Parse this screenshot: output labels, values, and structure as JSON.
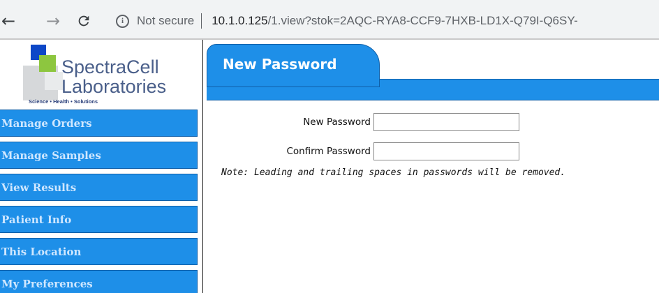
{
  "browser": {
    "nav": {
      "back_icon": "back-arrow-icon",
      "forward_icon": "forward-arrow-icon",
      "reload_icon": "reload-icon"
    },
    "security_label": "Not secure",
    "url_host": "10.1.0.125",
    "url_path": "/1.view?stok=2AQC-RYA8-CCF9-7HXB-LD1X-Q79I-Q6SY-"
  },
  "logo": {
    "name_line1": "SpectraCell",
    "name_line2": "Laboratories",
    "tagline": "Science  •  Health  •  Solutions"
  },
  "sidebar": {
    "items": [
      {
        "label": "Manage Orders"
      },
      {
        "label": "Manage Samples"
      },
      {
        "label": "View Results"
      },
      {
        "label": "Patient Info"
      },
      {
        "label": "This Location"
      },
      {
        "label": "My Preferences"
      }
    ]
  },
  "main": {
    "tab_title": "New Password",
    "form": {
      "new_password_label": "New Password",
      "new_password_value": "",
      "confirm_password_label": "Confirm Password",
      "confirm_password_value": ""
    },
    "note": "Note: Leading and trailing spaces in passwords will be removed."
  },
  "colors": {
    "accent_blue": "#1e8fe8",
    "logo_text": "#4a5f8a"
  }
}
